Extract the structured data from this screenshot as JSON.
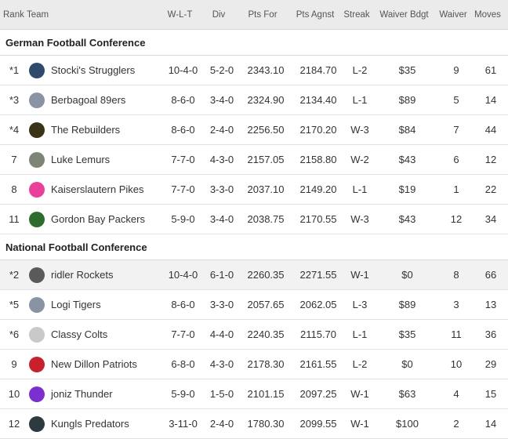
{
  "columns": {
    "rank": "Rank",
    "team": "Team",
    "wlt": "W-L-T",
    "div": "Div",
    "pts_for": "Pts For",
    "pts_agnst": "Pts Agnst",
    "streak": "Streak",
    "waiver_bdgt": "Waiver Bdgt",
    "waiver": "Waiver",
    "moves": "Moves"
  },
  "conferences": [
    {
      "name": "German Football Conference",
      "teams": [
        {
          "rank": "*1",
          "name": "Stocki's Strugglers",
          "wlt": "10-4-0",
          "div": "5-2-0",
          "pts_for": "2343.10",
          "pts_agnst": "2184.70",
          "streak": "L-2",
          "waiver_bdgt": "$35",
          "waiver": "9",
          "moves": "61",
          "logo_icon": "shield-star-icon",
          "logo_color": "#2f4a6b"
        },
        {
          "rank": "*3",
          "name": "Berbagoal 89ers",
          "wlt": "8-6-0",
          "div": "3-4-0",
          "pts_for": "2324.90",
          "pts_agnst": "2134.40",
          "streak": "L-1",
          "waiver_bdgt": "$89",
          "waiver": "5",
          "moves": "14",
          "logo_icon": "helmet-icon",
          "logo_color": "#8a93a3"
        },
        {
          "rank": "*4",
          "name": "The Rebuilders",
          "wlt": "8-6-0",
          "div": "2-4-0",
          "pts_for": "2256.50",
          "pts_agnst": "2170.20",
          "streak": "W-3",
          "waiver_bdgt": "$84",
          "waiver": "7",
          "moves": "44",
          "logo_icon": "crest-icon",
          "logo_color": "#3a3318"
        },
        {
          "rank": "7",
          "name": "Luke Lemurs",
          "wlt": "7-7-0",
          "div": "4-3-0",
          "pts_for": "2157.05",
          "pts_agnst": "2158.80",
          "streak": "W-2",
          "waiver_bdgt": "$43",
          "waiver": "6",
          "moves": "12",
          "logo_icon": "lemur-icon",
          "logo_color": "#7d8577"
        },
        {
          "rank": "8",
          "name": "Kaiserslautern Pikes",
          "wlt": "7-7-0",
          "div": "3-3-0",
          "pts_for": "2037.10",
          "pts_agnst": "2149.20",
          "streak": "L-1",
          "waiver_bdgt": "$19",
          "waiver": "1",
          "moves": "22",
          "logo_icon": "helmet-icon",
          "logo_color": "#e9419a"
        },
        {
          "rank": "11",
          "name": "Gordon Bay Packers",
          "wlt": "5-9-0",
          "div": "3-4-0",
          "pts_for": "2038.75",
          "pts_agnst": "2170.55",
          "streak": "W-3",
          "waiver_bdgt": "$43",
          "waiver": "12",
          "moves": "34",
          "logo_icon": "g-logo-icon",
          "logo_color": "#2e6b2e"
        }
      ]
    },
    {
      "name": "National Football Conference",
      "teams": [
        {
          "rank": "*2",
          "name": "ridler Rockets",
          "wlt": "10-4-0",
          "div": "6-1-0",
          "pts_for": "2260.35",
          "pts_agnst": "2271.55",
          "streak": "W-1",
          "waiver_bdgt": "$0",
          "waiver": "8",
          "moves": "66",
          "logo_icon": "rocket-badge-icon",
          "logo_color": "#5a5a5a"
        },
        {
          "rank": "*5",
          "name": "Logi Tigers",
          "wlt": "8-6-0",
          "div": "3-3-0",
          "pts_for": "2057.65",
          "pts_agnst": "2062.05",
          "streak": "L-3",
          "waiver_bdgt": "$89",
          "waiver": "3",
          "moves": "13",
          "logo_icon": "helmet-icon",
          "logo_color": "#8a93a3"
        },
        {
          "rank": "*6",
          "name": "Classy Colts",
          "wlt": "7-7-0",
          "div": "4-4-0",
          "pts_for": "2240.35",
          "pts_agnst": "2115.70",
          "streak": "L-1",
          "waiver_bdgt": "$35",
          "waiver": "11",
          "moves": "36",
          "logo_icon": "astronaut-icon",
          "logo_color": "#c9c9c9"
        },
        {
          "rank": "9",
          "name": "New Dillon Patriots",
          "wlt": "6-8-0",
          "div": "4-3-0",
          "pts_for": "2178.30",
          "pts_agnst": "2161.55",
          "streak": "L-2",
          "waiver_bdgt": "$0",
          "waiver": "10",
          "moves": "29",
          "logo_icon": "patriot-icon",
          "logo_color": "#c8202f"
        },
        {
          "rank": "10",
          "name": "joniz Thunder",
          "wlt": "5-9-0",
          "div": "1-5-0",
          "pts_for": "2101.15",
          "pts_agnst": "2097.25",
          "streak": "W-1",
          "waiver_bdgt": "$63",
          "waiver": "4",
          "moves": "15",
          "logo_icon": "thunder-icon",
          "logo_color": "#7b2fd0"
        },
        {
          "rank": "12",
          "name": "Kungls Predators",
          "wlt": "3-11-0",
          "div": "2-4-0",
          "pts_for": "1780.30",
          "pts_agnst": "2099.55",
          "streak": "W-1",
          "waiver_bdgt": "$100",
          "waiver": "2",
          "moves": "14",
          "logo_icon": "predator-icon",
          "logo_color": "#2d3a40"
        }
      ]
    }
  ]
}
